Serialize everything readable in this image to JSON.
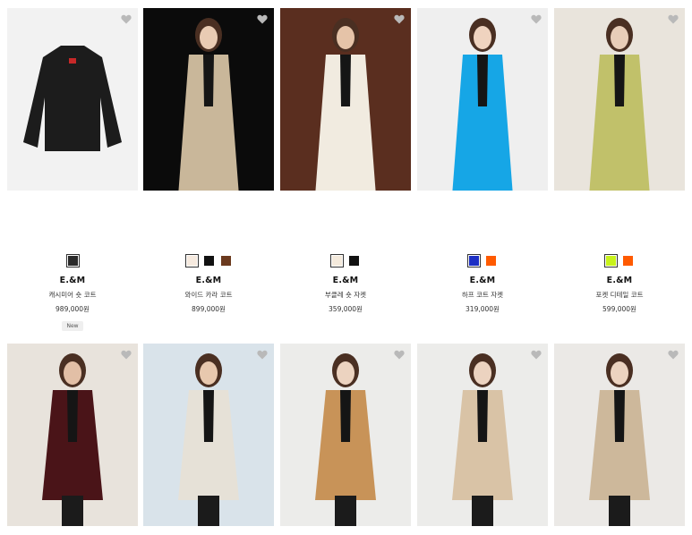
{
  "products": [
    {
      "brand": "E.&M",
      "name": "캐시미어 숏 코트",
      "price": "989,000원",
      "badge": "New",
      "swatches": [
        "#2b2b2b"
      ],
      "bg": "#f2f2f2",
      "garment": "#1c1c1c",
      "skin": "#e8c7b0"
    },
    {
      "brand": "E.&M",
      "name": "와이드 카라 코트",
      "price": "899,000원",
      "badge": "",
      "swatches": [
        "#f6eadf",
        "#111111",
        "#6b3a1e"
      ],
      "bg": "#0b0b0b",
      "garment": "#c9b79a",
      "skin": "#e9cbb3"
    },
    {
      "brand": "E.&M",
      "name": "부클레 숏 자켓",
      "price": "359,000원",
      "badge": "",
      "swatches": [
        "#f4eadc",
        "#111111"
      ],
      "bg": "#5a2e1f",
      "garment": "#f1ebe0",
      "skin": "#e5c3a8"
    },
    {
      "brand": "E.&M",
      "name": "하프 코트 자켓",
      "price": "319,000원",
      "badge": "",
      "swatches": [
        "#1d2fc4",
        "#ff5a00"
      ],
      "bg": "#efefef",
      "garment": "#16a6e6",
      "skin": "#efd3bf"
    },
    {
      "brand": "E.&M",
      "name": "포켓 디테일 코트",
      "price": "599,000원",
      "badge": "",
      "swatches": [
        "#c8f21a",
        "#ff5a00"
      ],
      "bg": "#e9e4dc",
      "garment": "#c1c16a",
      "skin": "#e8cdb8"
    },
    {
      "brand": "",
      "name": "",
      "price": "",
      "badge": "",
      "swatches": [],
      "bg": "#e8e3dc",
      "garment": "#4a1418",
      "skin": "#e2bfa6"
    },
    {
      "brand": "",
      "name": "",
      "price": "",
      "badge": "",
      "swatches": [],
      "bg": "#d9e3ea",
      "garment": "#e6e1d7",
      "skin": "#e8c8ae"
    },
    {
      "brand": "",
      "name": "",
      "price": "",
      "badge": "",
      "swatches": [],
      "bg": "#ececea",
      "garment": "#c89358",
      "skin": "#ecd3c0"
    },
    {
      "brand": "",
      "name": "",
      "price": "",
      "badge": "",
      "swatches": [],
      "bg": "#ececea",
      "garment": "#d9c3a6",
      "skin": "#ecd3c0"
    },
    {
      "brand": "",
      "name": "",
      "price": "",
      "badge": "",
      "swatches": [],
      "bg": "#ebe9e6",
      "garment": "#cdb89b",
      "skin": "#ecd3c0"
    }
  ]
}
